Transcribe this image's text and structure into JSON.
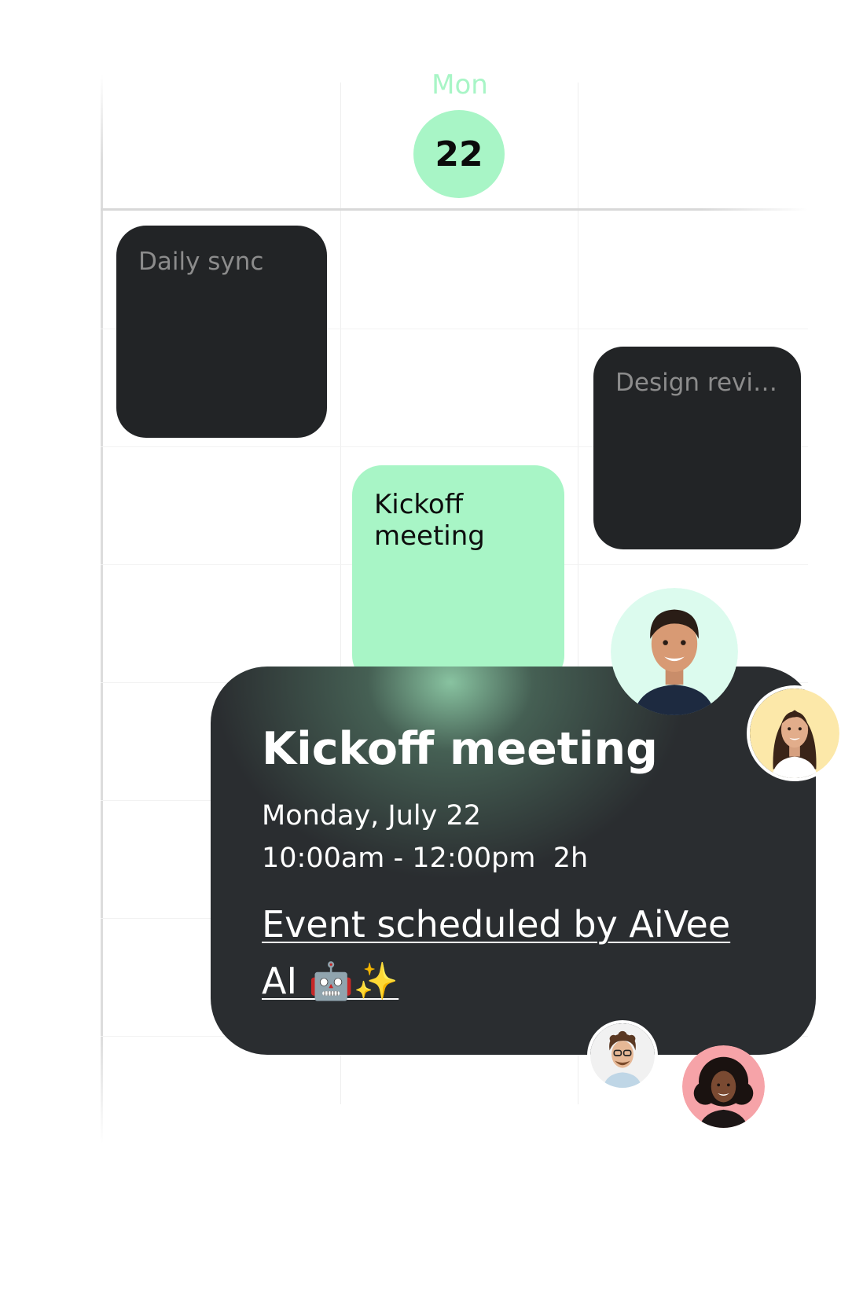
{
  "calendar": {
    "day_name": "Mon",
    "day_number": "22"
  },
  "events": {
    "daily_sync": "Daily sync",
    "design_review": "Design revi…",
    "kickoff": "Kickoff meeting"
  },
  "event_card": {
    "title": "Kickoff meeting",
    "date": "Monday, July 22",
    "time": "10:00am - 12:00pm  2h",
    "scheduled_by": "Event scheduled by AiVee AI 🤖✨"
  },
  "colors": {
    "accent": "#a8f5c6",
    "event_dark": "#222426",
    "card_bg": "#2a2d30"
  },
  "attendees": [
    {
      "icon": "avatar-man-icon"
    },
    {
      "icon": "avatar-woman-icon"
    },
    {
      "icon": "avatar-curly-man-icon"
    },
    {
      "icon": "avatar-woman-curly-icon"
    }
  ]
}
